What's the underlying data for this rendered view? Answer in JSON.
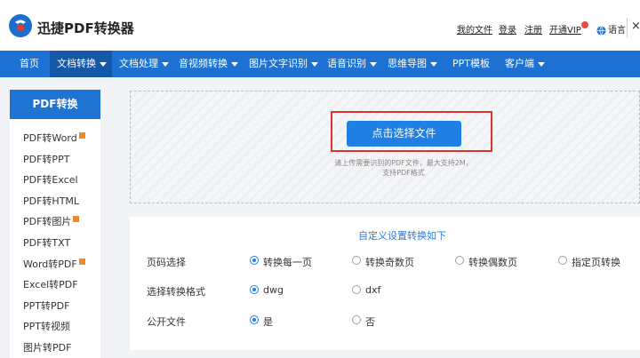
{
  "header": {
    "brand": "迅捷PDF转换器",
    "links": [
      "我的文件",
      "登录",
      "注册",
      "开通VIP"
    ],
    "language": "语言",
    "close": "×"
  },
  "nav": {
    "items": [
      "首页",
      "文档转换",
      "文档处理",
      "音视频转换",
      "图片文字识别",
      "语音识别",
      "思维导图",
      "PPT模板",
      "客户端"
    ],
    "active": "文档转换"
  },
  "sidebar": {
    "title": "PDF转换",
    "items": [
      "PDF转Word",
      "PDF转PPT",
      "PDF转Excel",
      "PDF转HTML",
      "PDF转图片",
      "PDF转TXT",
      "Word转PDF",
      "Excel转PDF",
      "PPT转PDF",
      "PPT转视频",
      "图片转PDF"
    ],
    "badged": [
      "PDF转Word",
      "PDF转图片",
      "Word转PDF"
    ]
  },
  "upload": {
    "button_label": "点击选择文件",
    "hint_line1": "请上传需要识别的PDF文件，最大支持2M，",
    "hint_line2": "支持PDF格式"
  },
  "settings": {
    "title": "自定义设置转换如下",
    "rows": [
      {
        "label": "页码选择",
        "options": [
          "转换每一页",
          "转换奇数页",
          "转换偶数页",
          "指定页转换"
        ],
        "selected": 0
      },
      {
        "label": "选择转换格式",
        "options": [
          "dwg",
          "dxf"
        ],
        "selected": 0
      },
      {
        "label": "公开文件",
        "options": [
          "是",
          "否"
        ],
        "selected": 0
      }
    ]
  },
  "colors": {
    "nav_blue": "#1c71d2",
    "nav_active": "#1558a8",
    "button_blue": "#1f7fe3",
    "highlight_red": "#e03131",
    "badge_orange": "#f08a24"
  }
}
